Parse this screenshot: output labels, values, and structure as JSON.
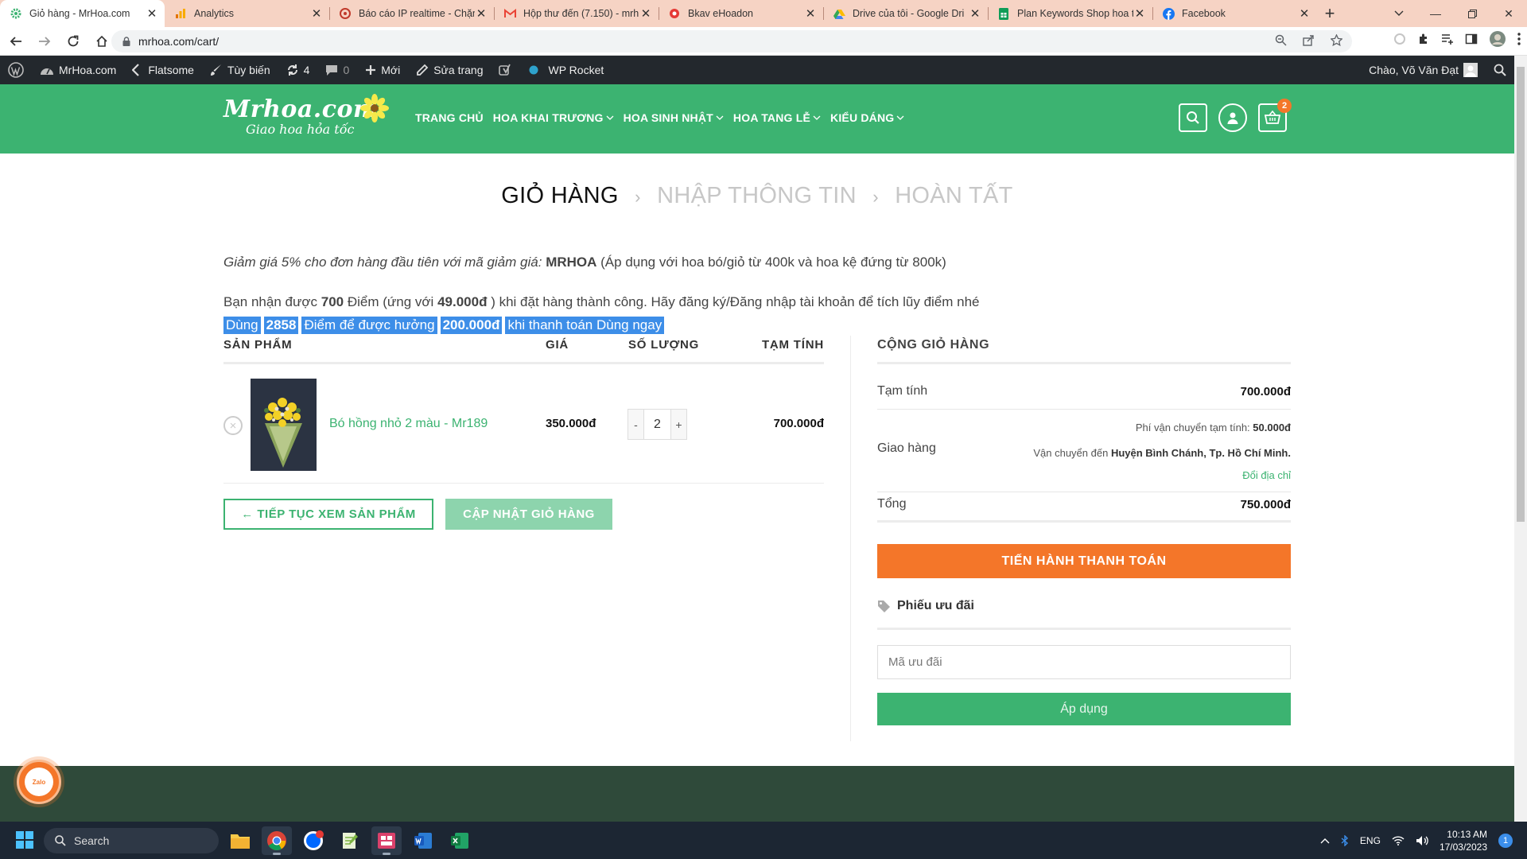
{
  "browser": {
    "tabs": [
      {
        "title": "Giỏ hàng - MrHoa.com",
        "icon": "gear-favicon",
        "color": "#3cb371",
        "active": true
      },
      {
        "title": "Analytics",
        "icon": "analytics-favicon",
        "color": "#f9ab00",
        "active": false
      },
      {
        "title": "Báo cáo IP realtime - Chặn",
        "icon": "shield-favicon",
        "color": "#e8453c",
        "active": false
      },
      {
        "title": "Hộp thư đến (7.150) - mrh",
        "icon": "gmail-favicon",
        "color": "#ea4335",
        "active": false
      },
      {
        "title": "Bkav eHoadon",
        "icon": "bkav-favicon",
        "color": "#e53935",
        "active": false
      },
      {
        "title": "Drive của tôi - Google Dri",
        "icon": "drive-favicon",
        "color": "#34a853",
        "active": false
      },
      {
        "title": "Plan Keywords Shop hoa tư",
        "icon": "sheets-favicon",
        "color": "#0f9d58",
        "active": false
      },
      {
        "title": "Facebook",
        "icon": "facebook-favicon",
        "color": "#1877f2",
        "active": false
      }
    ],
    "url": "mrhoa.com/cart/"
  },
  "wpbar": {
    "site": "MrHoa.com",
    "theme": "Flatsome",
    "customize": "Tùy biến",
    "updates": "4",
    "comments": "0",
    "new": "Mới",
    "edit": "Sửa trang",
    "rocket": "WP Rocket",
    "greeting": "Chào, Võ Văn Đạt"
  },
  "header": {
    "logo_line1": "Mrhoa.com",
    "logo_line2": "Giao hoa hỏa tốc",
    "nav": [
      "TRANG CHỦ",
      "HOA KHAI TRƯƠNG",
      "HOA SINH NHẬT",
      "HOA TANG LỄ",
      "KIỂU DÁNG"
    ],
    "cart_count": "2"
  },
  "steps": {
    "step1": "GIỎ HÀNG",
    "step2": "NHẬP THÔNG TIN",
    "step3": "HOÀN TẤT"
  },
  "notice": {
    "discount_text": "Giảm giá 5% cho đơn hàng đầu tiên với mã giảm giá:",
    "discount_code": "MRHOA",
    "discount_note": "(Áp dụng với hoa bó/giỏ từ 400k và hoa kệ đứng từ 800k)",
    "points_a": "Bạn nhận được",
    "points_value": "700",
    "points_b": "Điểm (ứng với",
    "points_money": "49.000đ",
    "points_c": ") khi đặt hàng thành công. Hãy đăng ký/Đăng nhập tài khoản để tích lũy điểm nhé",
    "use": [
      "Dùng",
      "2858",
      "Điểm để được hưởng",
      "200.000đ",
      "khi thanh toán Dùng ngay"
    ]
  },
  "cart": {
    "headers": {
      "product": "SẢN PHẨM",
      "price": "GIÁ",
      "qty": "SỐ LƯỢNG",
      "subtotal": "TẠM TÍNH"
    },
    "items": [
      {
        "name": "Bó hồng nhỏ 2 màu - Mr189",
        "price": "350.000đ",
        "qty": "2",
        "subtotal": "700.000đ"
      }
    ],
    "continue_btn": "← TIẾP TỤC XEM SẢN PHẨM",
    "update_btn": "CẬP NHẬT GIỎ HÀNG"
  },
  "totals": {
    "title": "CỘNG GIỎ HÀNG",
    "subtotal_label": "Tạm tính",
    "subtotal_value": "700.000đ",
    "shipping_label": "Giao hàng",
    "shipping_fee_label": "Phí vận chuyển tạm tính:",
    "shipping_fee": "50.000đ",
    "shipping_to": "Vận chuyển đến",
    "shipping_place": "Huyện Bình Chánh, Tp. Hồ Chí Minh.",
    "change_address": "Đổi địa chỉ",
    "total_label": "Tổng",
    "total_value": "750.000đ",
    "checkout_btn": "TIẾN HÀNH THANH TOÁN",
    "coupon_title": "Phiếu ưu đãi",
    "coupon_placeholder": "Mã ưu đãi",
    "apply_btn": "Áp dụng"
  },
  "zalo_label": "Zalo",
  "taskbar": {
    "search": "Search",
    "lang": "ENG",
    "time": "10:13 AM",
    "date": "17/03/2023",
    "notifications": "1"
  },
  "colors": {
    "brand_green": "#3cb371",
    "checkout_orange": "#f47629",
    "footer_dark": "#2f4a3a"
  }
}
